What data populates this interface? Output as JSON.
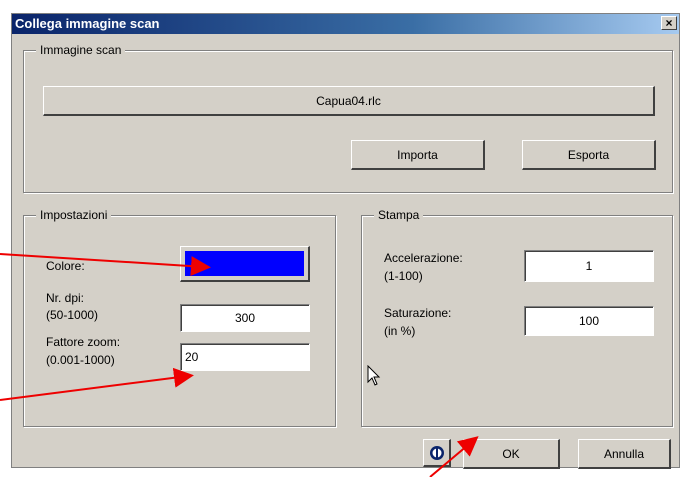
{
  "window": {
    "title": "Collega immagine scan",
    "close_glyph": "×"
  },
  "scan_group": {
    "legend": "Immagine scan",
    "file_button": "Capua04.rlc",
    "import_button": "Importa",
    "export_button": "Esporta"
  },
  "settings": {
    "legend": "Impostazioni",
    "color_label": "Colore:",
    "color_value": "#0000ff",
    "dpi_label_1": "Nr. dpi:",
    "dpi_label_2": "(50-1000)",
    "dpi_value": "300",
    "zoom_label_1": "Fattore zoom:",
    "zoom_label_2": "(0.001-1000)",
    "zoom_value": "20"
  },
  "print": {
    "legend": "Stampa",
    "accel_label_1": "Accelerazione:",
    "accel_label_2": "(1-100)",
    "accel_value": "1",
    "sat_label_1": "Saturazione:",
    "sat_label_2": "(in %)",
    "sat_value": "100"
  },
  "footer": {
    "info_icon": "info-icon",
    "ok_button": "OK",
    "cancel_button": "Annulla"
  },
  "annotations": {
    "arrow_color": "#ee0000"
  }
}
